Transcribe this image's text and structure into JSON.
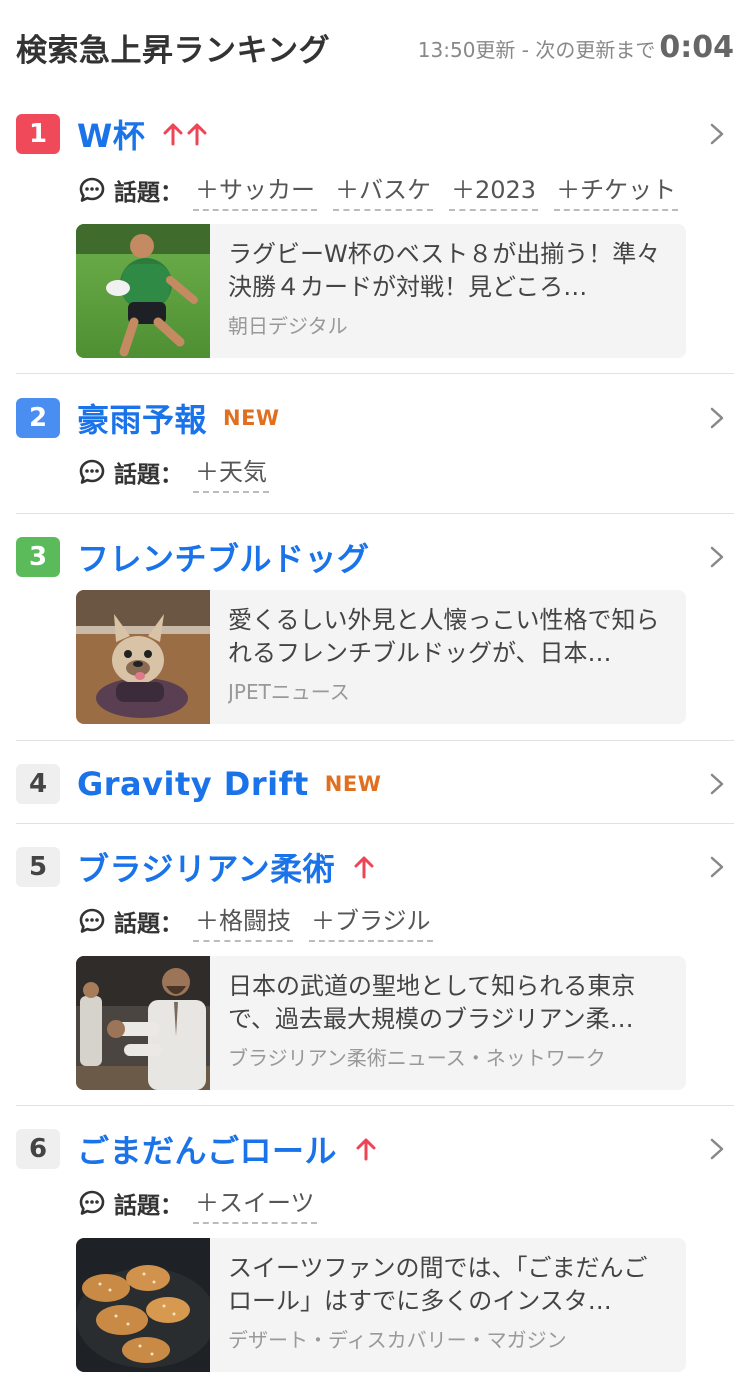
{
  "header": {
    "title": "検索急上昇ランキング",
    "updated": "13:50更新 - 次の更新まで",
    "countdown": "0:04"
  },
  "topics_label": "話題：",
  "colors": {
    "link": "#1a73e8",
    "trend": "#ee4455",
    "new": "#e07020"
  },
  "items": [
    {
      "rank": "1",
      "title": "W杯",
      "trend": "double-up",
      "topics": [
        "＋サッカー",
        "＋バスケ",
        "＋2023",
        "＋チケット"
      ],
      "news": {
        "desc": "ラグビーW杯のベスト８が出揃う！準々決勝４カードが対戦！見どころ…",
        "source": "朝日デジタル",
        "image": "rugby-player-photo"
      }
    },
    {
      "rank": "2",
      "title": "豪雨予報",
      "badge": "NEW",
      "topics": [
        "＋天気"
      ]
    },
    {
      "rank": "3",
      "title": "フレンチブルドッグ",
      "news": {
        "desc": "愛くるしい外見と人懐っこい性格で知られるフレンチブルドッグが、日本…",
        "source": "JPETニュース",
        "image": "french-bulldog-photo"
      }
    },
    {
      "rank": "4",
      "title": "Gravity Drift",
      "badge": "NEW"
    },
    {
      "rank": "5",
      "title": "ブラジリアン柔術",
      "trend": "up",
      "topics": [
        "＋格闘技",
        "＋ブラジル"
      ],
      "news": {
        "desc": "日本の武道の聖地として知られる東京で、過去最大規模のブラジリアン柔…",
        "source": "ブラジリアン柔術ニュース・ネットワーク",
        "image": "martial-artist-photo"
      }
    },
    {
      "rank": "6",
      "title": "ごまだんごロール",
      "trend": "up",
      "topics": [
        "＋スイーツ"
      ],
      "news": {
        "desc": "スイーツファンの間では、「ごまだんごロール」はすでに多くのインスタ…",
        "source": "デザート・ディスカバリー・マガジン",
        "image": "sesame-rolls-photo"
      }
    }
  ]
}
